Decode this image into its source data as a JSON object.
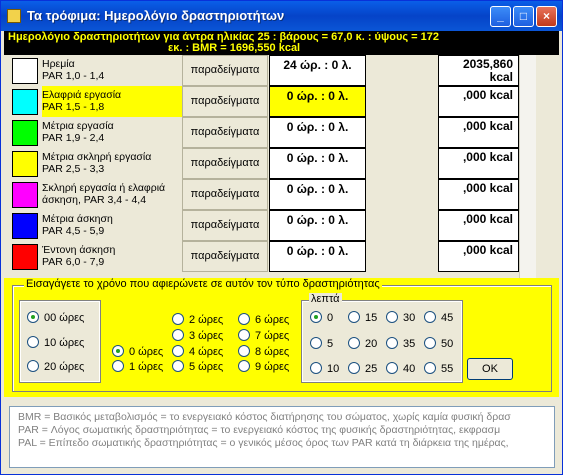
{
  "window": {
    "title": "Τα τρόφιμα: Ημερολόγιο δραστηριοτήτων",
    "min": "_",
    "max": "□",
    "close": "×"
  },
  "header": {
    "line1": "Ημερολόγιο δραστηριοτήτων για άντρα ηλικίας 25 :  βάρους = 67,0 κ. :  ύψους = 172",
    "line2": "εκ. :  BMR = 1696,550 kcal"
  },
  "activities": [
    {
      "label": "Ηρεμία",
      "par": "PAR 1,0 - 1,4",
      "color": "#FFFFFF",
      "button": "παραδείγματα",
      "time": "24 ώρ. : 0 λ.",
      "kcal": "2035,860 kcal",
      "highlight": false
    },
    {
      "label": "Ελαφριά εργασία",
      "par": "PAR 1,5 - 1,8",
      "color": "#00FFFF",
      "button": "παραδείγματα",
      "time": "0 ώρ. : 0 λ.",
      "kcal": ",000 kcal",
      "highlight": true
    },
    {
      "label": "Μέτρια εργασία",
      "par": "PAR 1,9 - 2,4",
      "color": "#00FF00",
      "button": "παραδείγματα",
      "time": "0 ώρ. : 0 λ.",
      "kcal": ",000 kcal",
      "highlight": false
    },
    {
      "label": "Μέτρια σκληρή εργασία",
      "par": "PAR 2,5 - 3,3",
      "color": "#FFFF00",
      "button": "παραδείγματα",
      "time": "0 ώρ. : 0 λ.",
      "kcal": ",000 kcal",
      "highlight": false
    },
    {
      "label": "Σκληρή εργασία ή ελαφριά",
      "par": "άσκηση, PAR 3,4 - 4,4",
      "color": "#FF00FF",
      "button": "παραδείγματα",
      "time": "0 ώρ. : 0 λ.",
      "kcal": ",000 kcal",
      "highlight": false
    },
    {
      "label": "Μέτρια άσκηση",
      "par": "PAR 4,5 - 5,9",
      "color": "#0000FF",
      "button": "παραδείγματα",
      "time": "0 ώρ. : 0 λ.",
      "kcal": ",000 kcal",
      "highlight": false
    },
    {
      "label": "Έντονη άσκηση",
      "par": "PAR 6,0 - 7,9",
      "color": "#FF0000",
      "button": "παραδείγματα",
      "time": "0 ώρ. : 0 λ.",
      "kcal": ",000 kcal",
      "highlight": false
    }
  ],
  "panel": {
    "legend": "Εισαγάγετε το χρόνο που αφιερώνετε σε αυτόν τον τύπο δραστηριότητας",
    "tens": [
      "00 ώρες",
      "10 ώρες",
      "20 ώρες"
    ],
    "tens_selected": 0,
    "units_a": [
      "0 ώρες",
      "1 ώρες"
    ],
    "units_b": [
      "2 ώρες",
      "3 ώρες",
      "4 ώρες",
      "5 ώρες"
    ],
    "units_c": [
      "6 ώρες",
      "7 ώρες",
      "8 ώρες",
      "9 ώρες"
    ],
    "units_selected": "0 ώρες",
    "minutes_title": "λεπτά",
    "minutes": [
      "0",
      "15",
      "30",
      "45",
      "5",
      "20",
      "35",
      "50",
      "10",
      "25",
      "40",
      "55"
    ],
    "minutes_selected": "0",
    "ok": "OK"
  },
  "notes": [
    "BMR = Βασικός μεταβολισμός = το ενεργειακό κόστος διατήρησης του σώματος, χωρίς καμία φυσική δρασ",
    "PAR = Λόγος σωματικής δραστηριότητας = το ενεργειακό κόστος της φυσικής δραστηριότητας, εκφρασμ",
    "PAL = Επίπεδο σωματικής δραστηριότητας = ο γενικός μέσος όρος των PAR κατά τη διάρκεια της ημέρας,"
  ]
}
